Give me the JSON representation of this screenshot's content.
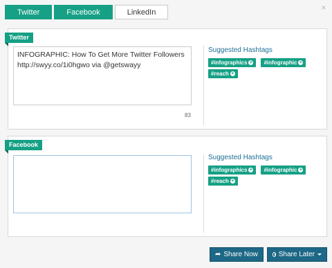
{
  "tabs": [
    {
      "label": "Twitter",
      "active": true
    },
    {
      "label": "Facebook",
      "active": true
    },
    {
      "label": "LinkedIn",
      "active": false
    }
  ],
  "close_label": "×",
  "twitter": {
    "ribbon": "Twitter",
    "text": "INFOGRAPHIC: How To Get More Twitter Followers\nhttp://swyy.co/1i0hgwo via @getswayy",
    "char_count": "83",
    "hashtags_title": "Suggested Hashtags",
    "hashtags": [
      "#infographics",
      "#infographic",
      "#reach"
    ]
  },
  "facebook": {
    "ribbon": "Facebook",
    "text": "",
    "hashtags_title": "Suggested Hashtags",
    "hashtags": [
      "#infographics",
      "#infographic",
      "#reach"
    ]
  },
  "actions": {
    "share_now": "Share Now",
    "share_later": "Share Later"
  },
  "colors": {
    "accent": "#16a085",
    "button": "#1d6886",
    "title_blue": "#1b6f93"
  }
}
